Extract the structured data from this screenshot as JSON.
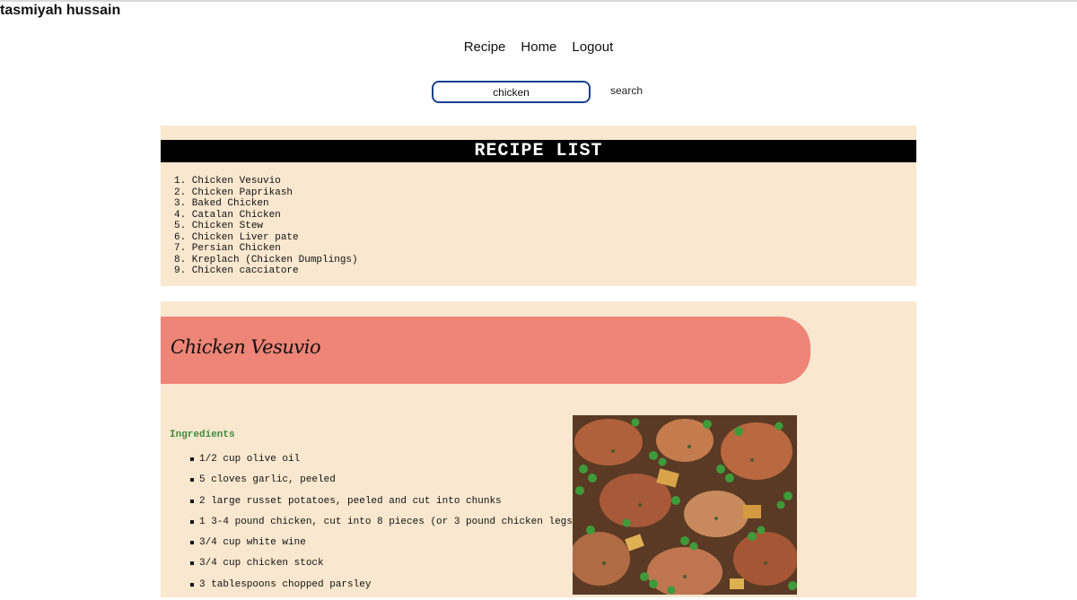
{
  "user": {
    "name": "tasmiyah hussain"
  },
  "nav": {
    "items": [
      "Recipe",
      "Home",
      "Logout"
    ]
  },
  "search": {
    "value": "chicken",
    "button_label": "search"
  },
  "recipe_list": {
    "heading": "RECIPE LIST",
    "items": [
      "1. Chicken Vesuvio",
      "2. Chicken Paprikash",
      "3. Baked Chicken",
      "4. Catalan Chicken",
      "5. Chicken Stew",
      "6. Chicken Liver pate",
      "7. Persian Chicken",
      "8. Kreplach (Chicken Dumplings)",
      "9. Chicken cacciatore"
    ]
  },
  "recipe": {
    "title": "Chicken Vesuvio",
    "ingredients_heading": "Ingredients",
    "ingredients": [
      "1/2 cup olive oil",
      "5 cloves garlic, peeled",
      "2 large russet potatoes, peeled and cut into chunks",
      "1 3-4 pound chicken, cut into 8 pieces (or 3 pound chicken legs)",
      "3/4 cup white wine",
      "3/4 cup chicken stock",
      "3 tablespoons chopped parsley"
    ]
  },
  "colors": {
    "panel_bg": "#f9e7cf",
    "title_pill": "#ee8577",
    "banner_bg": "#000000",
    "ingredients_heading": "#3c8a3c",
    "search_border": "#1a3f8f"
  }
}
